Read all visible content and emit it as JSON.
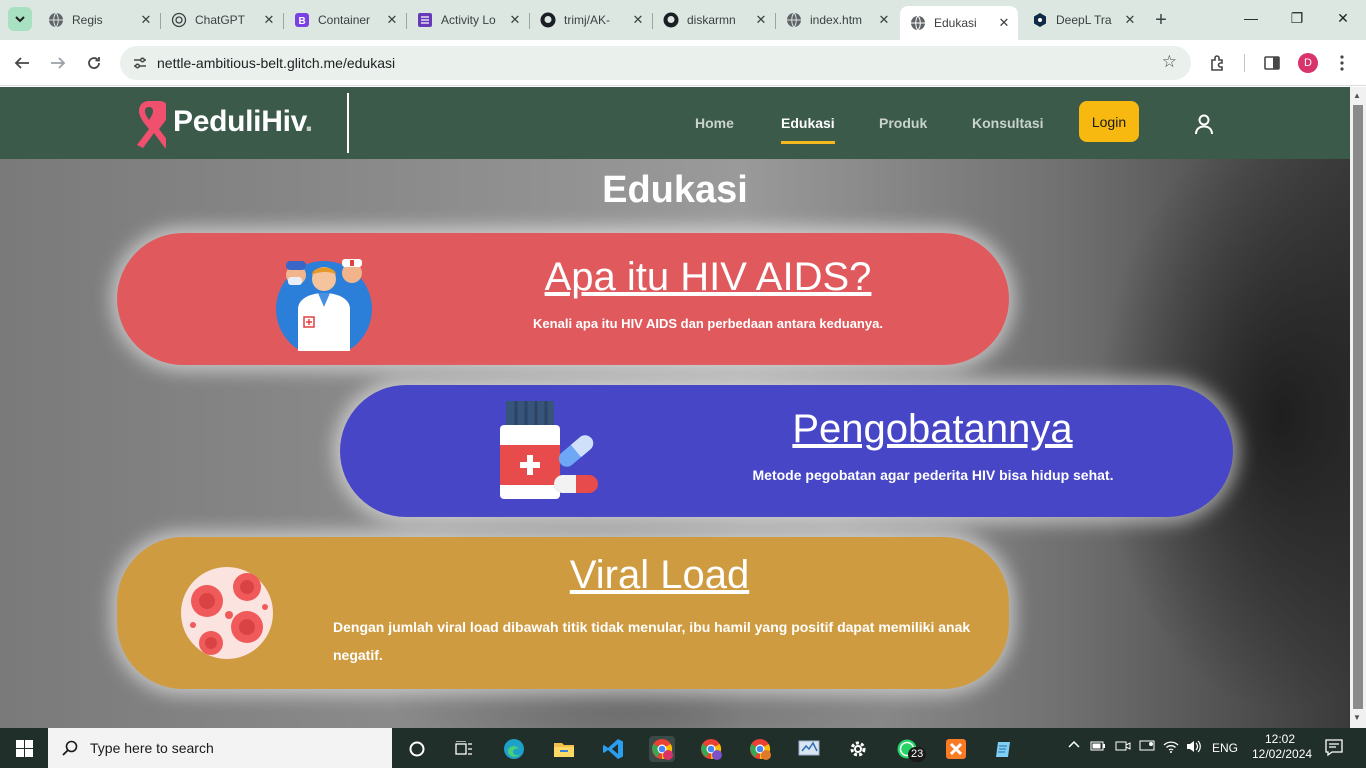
{
  "browser": {
    "tabs": [
      {
        "title": "Regis",
        "icon": "globe-icon"
      },
      {
        "title": "ChatGPT",
        "icon": "chatgpt-icon"
      },
      {
        "title": "Container",
        "icon": "bootstrap-icon"
      },
      {
        "title": "Activity Lo",
        "icon": "list-icon"
      },
      {
        "title": "trimj/AK-",
        "icon": "github-icon"
      },
      {
        "title": "diskarmn",
        "icon": "github-icon"
      },
      {
        "title": "index.htm",
        "icon": "globe-icon"
      },
      {
        "title": "Edukasi",
        "icon": "globe-icon",
        "active": true
      },
      {
        "title": "DeepL Tra",
        "icon": "deepl-icon"
      }
    ],
    "url": "nettle-ambitious-belt.glitch.me/edukasi",
    "profile_initial": "D"
  },
  "site": {
    "brand": "PeduliHiv",
    "brand_dot": ".",
    "nav": [
      "Home",
      "Edukasi",
      "Produk",
      "Konsultasi"
    ],
    "active_nav": "Edukasi",
    "login_label": "Login",
    "heading": "Edukasi",
    "cards": [
      {
        "title": "Apa itu HIV AIDS?",
        "desc": "Kenali apa itu HIV AIDS dan perbedaan antara keduanya.",
        "color": "#e05a5d",
        "icon": "medical-staff-icon"
      },
      {
        "title": "Pengobatannya",
        "desc": "Metode pegobatan agar pederita HIV bisa hidup sehat.",
        "color": "#4646c6",
        "icon": "medicine-bottle-icon"
      },
      {
        "title": "Viral Load",
        "desc": "Dengan jumlah viral load dibawah titik tidak menular, ibu hamil yang positif dapat memiliki anak negatif.",
        "color": "#cf9b40",
        "icon": "blood-cells-icon"
      }
    ],
    "accent": "#f7b90f",
    "nav_bg": "#3b5a4a"
  },
  "taskbar": {
    "search_placeholder": "Type here to search",
    "whatsapp_badge": "23",
    "language": "ENG",
    "time": "12:02",
    "date": "12/02/2024"
  }
}
